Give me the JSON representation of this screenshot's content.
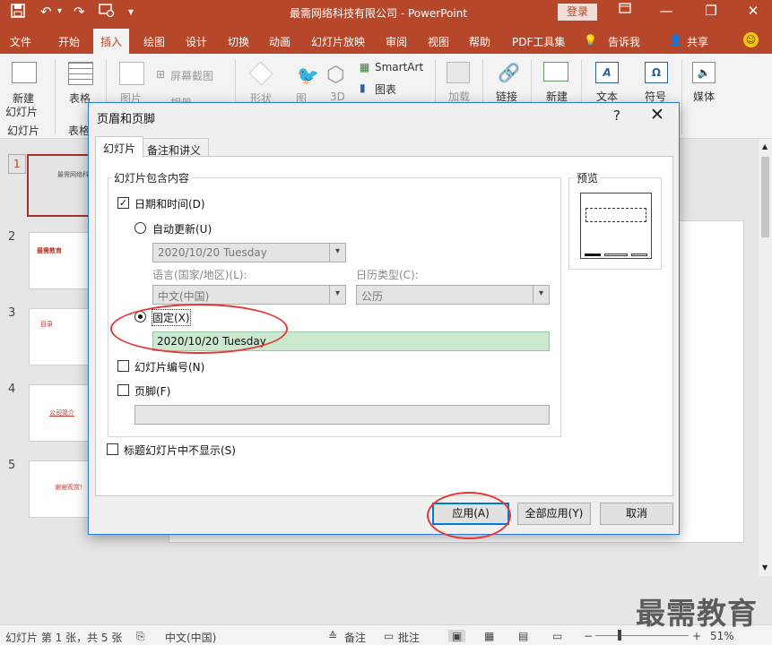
{
  "titlebar": {
    "title": "最需网络科技有限公司  -  PowerPoint",
    "login": "登录",
    "minimize_glyph": "—",
    "restore_glyph": "❐",
    "close_glyph": "✕",
    "quick_access": {
      "save_icon": "save-icon",
      "undo_icon": "undo-icon",
      "redo_icon": "redo-icon",
      "present_icon": "present-from-start-icon",
      "customize_glyph": "▾"
    }
  },
  "menu": {
    "tabs": [
      "文件",
      "开始",
      "插入",
      "绘图",
      "设计",
      "切换",
      "动画",
      "幻灯片放映",
      "审阅",
      "视图",
      "帮助",
      "PDF工具集"
    ],
    "active_tab": "插入",
    "tellme": "告诉我",
    "share": "共享"
  },
  "ribbon": {
    "new_slide": "新建\n幻灯片",
    "new_slide_label": "新建",
    "new_slide_label2": "幻灯片",
    "slides_group": "幻灯片",
    "table": "表格",
    "table_group": "表格",
    "picture": "图片",
    "screenshot": "屏幕截图",
    "album": "相册",
    "shape": "形状",
    "icon": "图",
    "model3d": "3D",
    "smartart": "SmartArt",
    "chart": "图表",
    "addin": "加载",
    "link": "链接",
    "comment": "新建",
    "text": "文本",
    "symbol": "符号",
    "media": "媒体"
  },
  "thumbnails": [
    {
      "num": "1",
      "text": "最需网络科技有",
      "selected": true
    },
    {
      "num": "2",
      "text": "最需教育",
      "selected": false
    },
    {
      "num": "3",
      "text": "目录",
      "selected": false
    },
    {
      "num": "4",
      "text": "公司简介",
      "selected": false
    },
    {
      "num": "5",
      "text": "谢谢观赏！",
      "selected": false
    }
  ],
  "dialog": {
    "title": "页眉和页脚",
    "help": "?",
    "close": "✕",
    "tabs": [
      "幻灯片",
      "备注和讲义"
    ],
    "group_label": "幻灯片包含内容",
    "datetime_label": "日期和时间(D)",
    "datetime_checked": true,
    "auto_update_label": "自动更新(U)",
    "auto_update_value": "2020/10/20 Tuesday",
    "language_label": "语言(国家/地区)(L):",
    "language_value": "中文(中国)",
    "calendar_label": "日历类型(C):",
    "calendar_value": "公历",
    "fixed_label": "固定(X)",
    "fixed_value": "2020/10/20 Tuesday",
    "fixed_selected": true,
    "slide_number_label": "幻灯片编号(N)",
    "slide_number_checked": false,
    "footer_label": "页脚(F)",
    "footer_checked": false,
    "footer_value": "",
    "hide_title_label": "标题幻灯片中不显示(S)",
    "hide_title_checked": false,
    "preview_label": "预览",
    "apply": "应用(A)",
    "apply_all": "全部应用(Y)",
    "cancel": "取消"
  },
  "statusbar": {
    "slide_info": "幻灯片 第 1 张，共 5 张",
    "language": "中文(中国)",
    "notes": "备注",
    "comments": "批注",
    "zoom": "51%"
  },
  "watermark": "最需教育",
  "colors": {
    "accent": "#b7472a",
    "annotation": "#e53935",
    "focus": "#0078d7"
  }
}
